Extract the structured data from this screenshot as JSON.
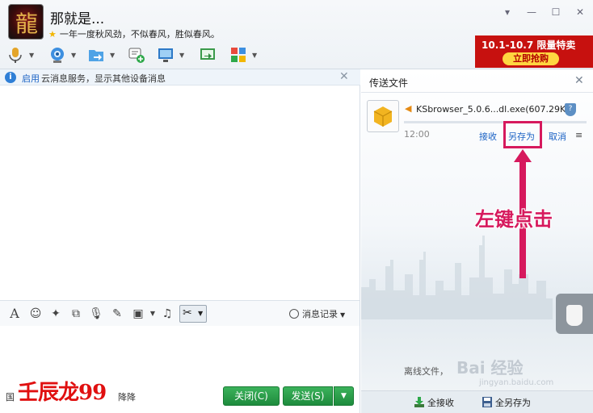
{
  "window": {
    "contact_name": "那就是...",
    "signature": "一年一度秋风劲，不似春风，胜似春风。",
    "controls": {
      "menu": "▾",
      "minimize": "—",
      "maximize": "☐",
      "close": "✕"
    }
  },
  "promo": {
    "line1": "10.1-10.7 限量特卖",
    "line2": "立即抢购"
  },
  "toolbar": {
    "icons": [
      "microphone-icon",
      "video-camera-icon",
      "file-transfer-icon",
      "new-chat-icon",
      "remote-desktop-icon",
      "share-screen-icon",
      "apps-grid-icon"
    ]
  },
  "info_bar": {
    "link": "启用",
    "text": "云消息服务，显示其他设备消息"
  },
  "input_toolbar": {
    "history_label": "消息记录"
  },
  "bottom": {
    "hint_left": "国",
    "hint_right": "降降",
    "close_label": "关闭(C)",
    "send_label": "发送(S)"
  },
  "watermark_left": "壬辰龙99",
  "transfer_panel": {
    "title": "传送文件",
    "file_name": "KSbrowser_5.0.6...dl.exe(607.29KB)",
    "time": "12:00",
    "accept_label": "接收",
    "save_as_label": "另存为",
    "cancel_label": "取消",
    "annotation": "左键点击",
    "offline_hint": "离线文件，",
    "watermark": "Bai 经验",
    "watermark_small": "jingyan.baidu.com",
    "accept_all_label": "全接收",
    "save_all_label": "全另存为"
  },
  "colors": {
    "accent_blue": "#1a62c4",
    "send_green": "#2a9d4a",
    "annotation_pink": "#d6195d",
    "promo_red": "#c7110f"
  }
}
